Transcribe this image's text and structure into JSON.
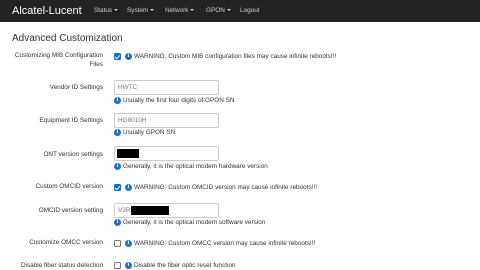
{
  "navbar": {
    "brand": "Alcatel-Lucent",
    "items": [
      {
        "label": "Status",
        "dropdown": true
      },
      {
        "label": "System",
        "dropdown": true
      },
      {
        "label": "Network",
        "dropdown": true
      },
      {
        "label": "GPON",
        "dropdown": true
      },
      {
        "label": "Logout",
        "dropdown": false
      }
    ]
  },
  "page": {
    "title": "Advanced Customization"
  },
  "settings": {
    "custom_mib": {
      "label": "Customizing MIB Configuration Files",
      "checked": true,
      "warning": "WARNING: Custom MIB configuration files may cause infinite reboots!!!"
    },
    "vendor_id": {
      "label": "Vendor ID Settings",
      "placeholder": "HWTC",
      "help": "Usually the first four digits of GPON SN"
    },
    "equipment_id": {
      "label": "Equipment ID Settings",
      "placeholder": "HG8010H",
      "help": "Usually GPON SN"
    },
    "ont_version": {
      "label": "ONT version settings",
      "value_redacted": true,
      "help": "Generally, it is the optical modem hardware version"
    },
    "custom_omcid": {
      "label": "Custom OMCID version",
      "checked": true,
      "warning": "WARNING: Custom OMCID version may cause infinite reboots!!!"
    },
    "omcid_version": {
      "label": "OMCID version setting",
      "value_prefix": "V3R",
      "value_redacted": true,
      "help": "Generally, it is the optical modem software version"
    },
    "custom_omcc": {
      "label": "Customize OMCC version",
      "checked": false,
      "warning": "WARNING: Custom OMCC version may cause infinite reboots!!!"
    },
    "disable_fiber": {
      "label": "Disable fiber status detection",
      "checked": false,
      "help": "Disable the fiber optic reset function"
    }
  },
  "colors": {
    "navbar_bg": "#222222",
    "checkbox_accent": "#0a6fd8",
    "info_icon": "#1f6fd1"
  },
  "icons": {
    "info": "info-circle-icon",
    "dropdown": "caret-down-icon"
  }
}
